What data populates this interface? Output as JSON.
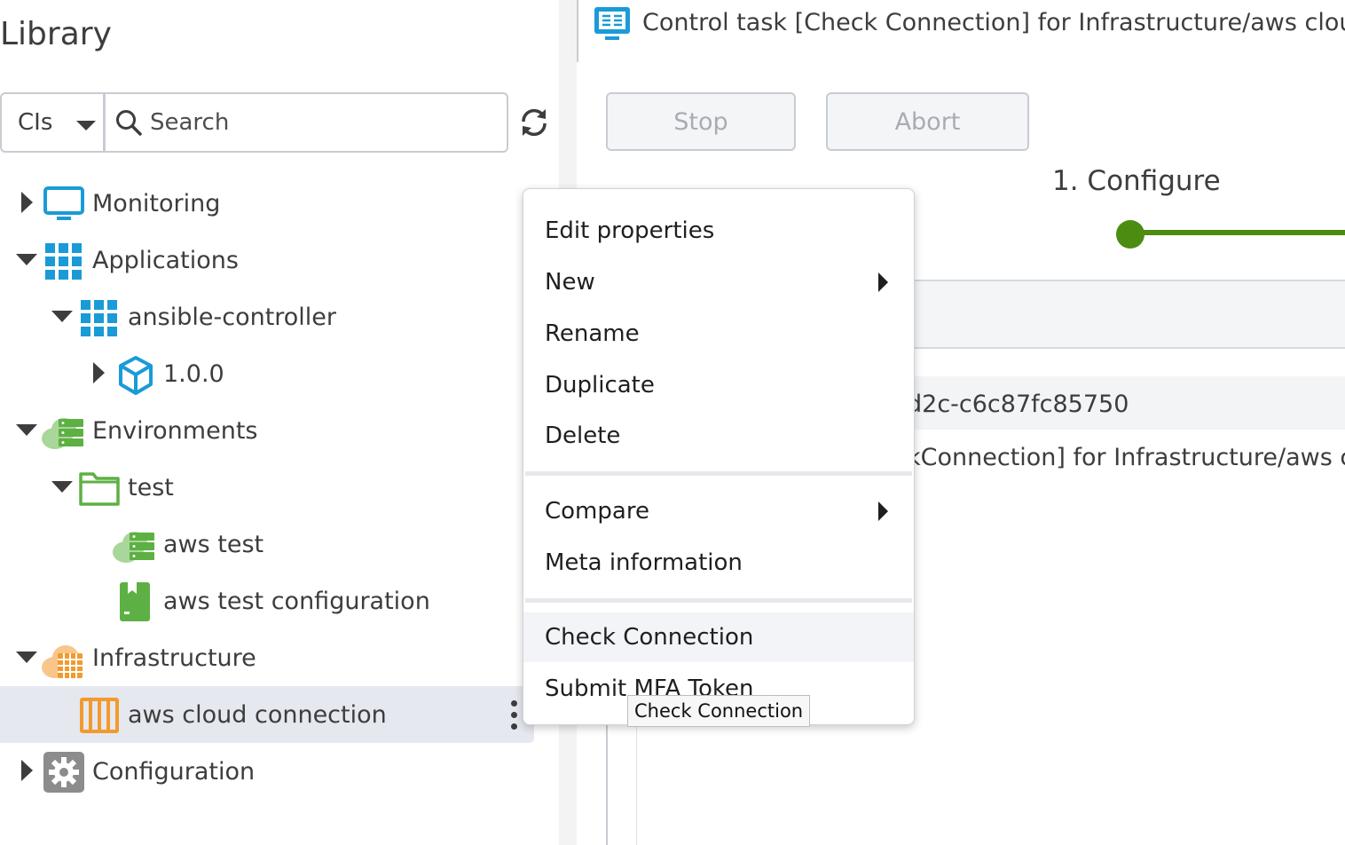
{
  "library": {
    "title": "Library",
    "type_select": "CIs",
    "search_placeholder": "Search"
  },
  "tree": {
    "monitoring": "Monitoring",
    "applications": "Applications",
    "ansible_controller": "ansible-controller",
    "version": "1.0.0",
    "environments": "Environments",
    "test": "test",
    "aws_test": "aws test",
    "aws_test_configuration": "aws test configuration",
    "infrastructure": "Infrastructure",
    "aws_cloud_connection": "aws cloud connection",
    "configuration": "Configuration"
  },
  "task": {
    "title": "Control task [Check Connection] for Infrastructure/aws cloud co",
    "stop_label": "Stop",
    "abort_label": "Abort",
    "step_label": "1. Configure",
    "id_text": "d2c-c6c87fc85750",
    "desc_text": "kConnection] for Infrastructure/aws clo"
  },
  "context_menu": {
    "edit_properties": "Edit properties",
    "new": "New",
    "rename": "Rename",
    "duplicate": "Duplicate",
    "delete": "Delete",
    "compare": "Compare",
    "meta_information": "Meta information",
    "check_connection": "Check Connection",
    "submit_mfa_token": "Submit MFA Token"
  },
  "tooltip": "Check Connection",
  "colors": {
    "accent_blue": "#1a9bd7",
    "env_green": "#5db043",
    "infra_orange": "#f29a2e",
    "progress_green": "#4c8c10",
    "selected_bg": "#e5e8ee"
  }
}
